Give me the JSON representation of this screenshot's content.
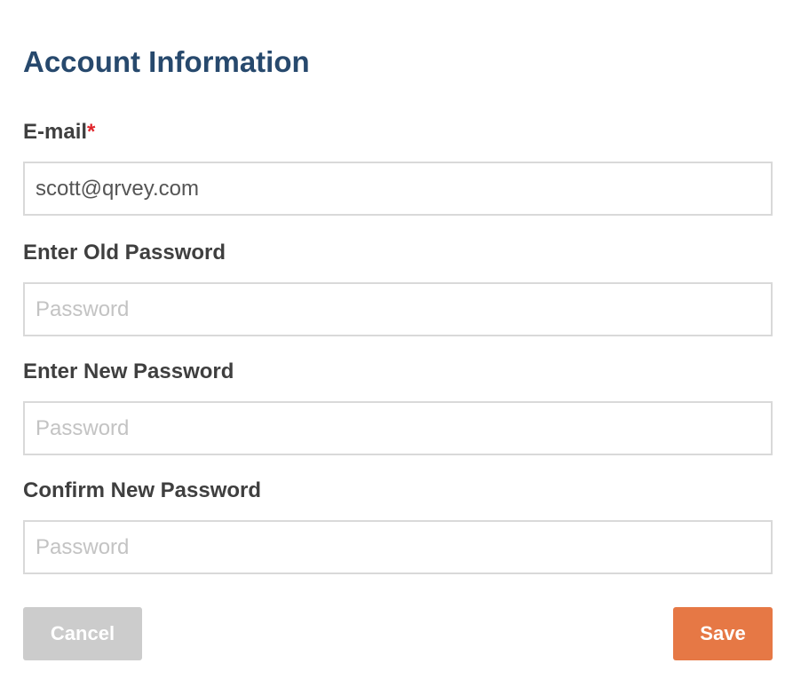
{
  "section": {
    "title": "Account Information"
  },
  "email": {
    "label": "E-mail",
    "required_marker": "*",
    "value": "scott@qrvey.com"
  },
  "old_password": {
    "label": "Enter Old Password",
    "placeholder": "Password"
  },
  "new_password": {
    "label": "Enter New Password",
    "placeholder": "Password"
  },
  "confirm_password": {
    "label": "Confirm New Password",
    "placeholder": "Password"
  },
  "actions": {
    "cancel_label": "Cancel",
    "save_label": "Save"
  },
  "colors": {
    "title": "#27496d",
    "required": "#e0252b",
    "cancel_button": "#cccccc",
    "save_button": "#e67845"
  }
}
